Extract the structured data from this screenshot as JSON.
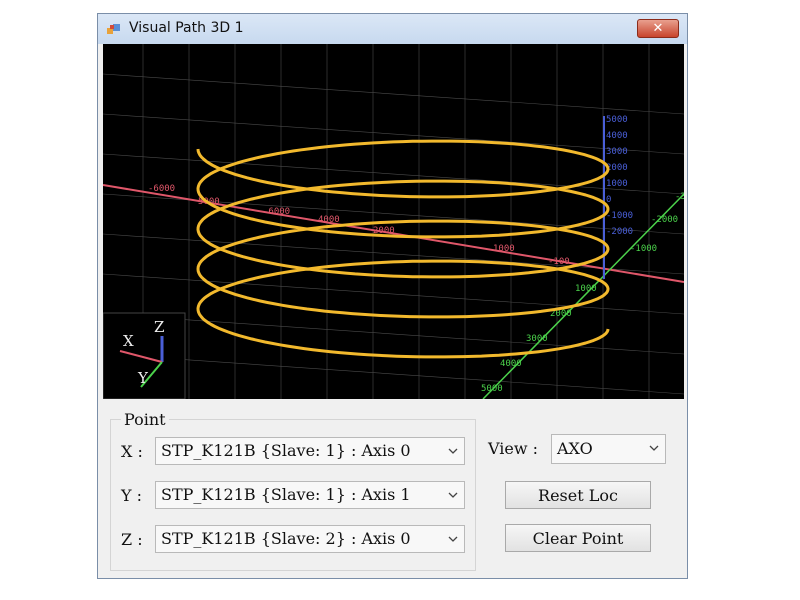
{
  "window": {
    "title": "Visual Path 3D 1",
    "close_glyph": "✕"
  },
  "viewport": {
    "gizmo": {
      "x": "X",
      "y": "Y",
      "z": "Z"
    },
    "x_axis_ticks": [
      "-6000",
      "5000",
      "-6000",
      "4000",
      "2000",
      "1000",
      "-100"
    ],
    "y_axis_ticks": [
      "-1000",
      "-2000",
      "1000",
      "2000",
      "3000",
      "4000",
      "5000",
      "-3"
    ],
    "z_axis_ticks": [
      "5000",
      "4000",
      "3000",
      "2000",
      "1000",
      "0",
      "-1000",
      "-2000"
    ]
  },
  "point": {
    "legend": "Point",
    "rows": [
      {
        "label": "X :",
        "value": "STP_K121B {Slave: 1} : Axis 0"
      },
      {
        "label": "Y :",
        "value": "STP_K121B {Slave: 1} : Axis 1"
      },
      {
        "label": "Z :",
        "value": "STP_K121B {Slave: 2} : Axis 0"
      }
    ]
  },
  "view": {
    "label": "View :",
    "value": "AXO"
  },
  "buttons": {
    "reset_loc": "Reset Loc",
    "clear_point": "Clear Point"
  },
  "colors": {
    "path": "#f2b92d",
    "x_axis": "#e0576a",
    "y_axis": "#4bd14b",
    "z_axis": "#4a5fd8",
    "grid": "#4a4a4a"
  }
}
